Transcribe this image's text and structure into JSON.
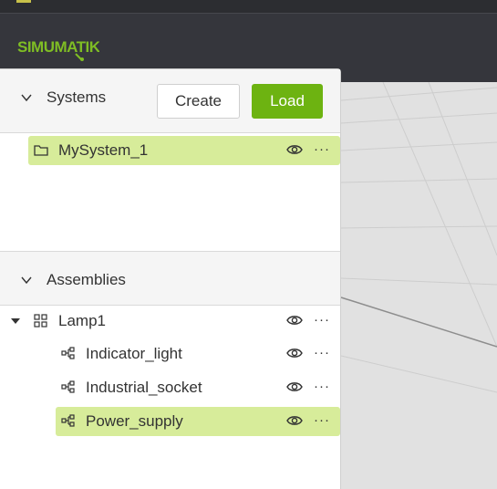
{
  "app": {
    "brand": "SIMUMATIK"
  },
  "systems": {
    "title": "Systems",
    "create_label": "Create",
    "load_label": "Load",
    "items": [
      {
        "label": "MySystem_1",
        "selected": true
      }
    ]
  },
  "assemblies": {
    "title": "Assemblies",
    "items": [
      {
        "label": "Lamp1",
        "expanded": true,
        "children": [
          {
            "label": "Indicator_light"
          },
          {
            "label": "Industrial_socket"
          },
          {
            "label": "Power_supply",
            "selected": true
          }
        ]
      }
    ]
  },
  "more_glyph": "···",
  "colors": {
    "accent": "#6db311",
    "selection": "#d7ec9a",
    "header": "#35363c"
  }
}
